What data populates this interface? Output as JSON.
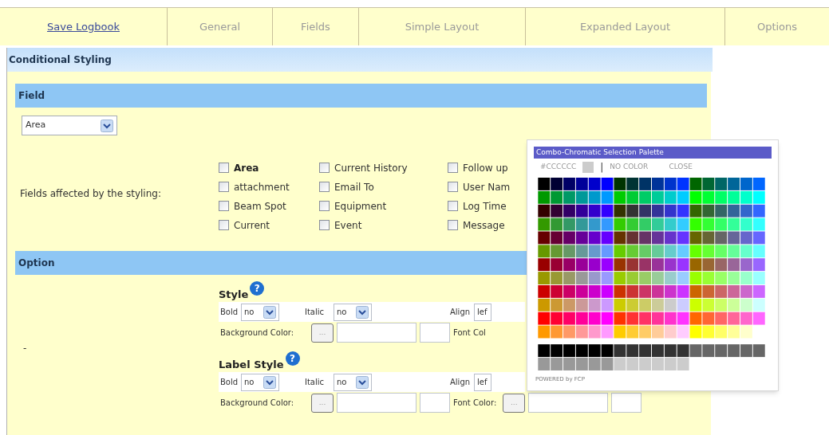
{
  "tabs": [
    {
      "label": "Save Logbook",
      "kind": "link"
    },
    {
      "label": "General",
      "kind": "tab"
    },
    {
      "label": "Fields",
      "kind": "tab"
    },
    {
      "label": "Simple Layout",
      "kind": "tab"
    },
    {
      "label": "Expanded Layout",
      "kind": "tab"
    },
    {
      "label": "Options",
      "kind": "tab"
    }
  ],
  "section_title": "Conditional Styling",
  "field_section": {
    "title": "Field",
    "select_value": "Area",
    "affected_label": "Fields affected by the styling:",
    "checkbox_columns": [
      [
        {
          "label": "Area",
          "checked": false,
          "highlighted": true
        },
        {
          "label": "attachment",
          "checked": false,
          "highlighted": false
        },
        {
          "label": "Beam Spot",
          "checked": false,
          "highlighted": false
        },
        {
          "label": "Current",
          "checked": false,
          "highlighted": false
        }
      ],
      [
        {
          "label": "Current History",
          "checked": false,
          "highlighted": false
        },
        {
          "label": "Email To",
          "checked": false,
          "highlighted": false
        },
        {
          "label": "Equipment",
          "checked": false,
          "highlighted": false
        },
        {
          "label": "Event",
          "checked": false,
          "highlighted": false
        }
      ],
      [
        {
          "label": "Follow up",
          "checked": false,
          "highlighted": false
        },
        {
          "label": "User Nam",
          "checked": false,
          "highlighted": false
        },
        {
          "label": "Log Time",
          "checked": false,
          "highlighted": false
        },
        {
          "label": "Message",
          "checked": false,
          "highlighted": false
        }
      ]
    ]
  },
  "option_section": {
    "title": "Option",
    "left_text": "-",
    "groups": [
      {
        "title": "Style",
        "help_icon": "?",
        "bold_label": "Bold",
        "bold_value": "no",
        "italic_label": "Italic",
        "italic_value": "no",
        "align_label": "Align",
        "align_value": "lef",
        "background_label": "Background Color:",
        "background_button": "...",
        "font_label": "Font Col"
      },
      {
        "title": "Label Style",
        "help_icon": "?",
        "bold_label": "Bold",
        "bold_value": "no",
        "italic_label": "Italic",
        "italic_value": "no",
        "align_label": "Align",
        "align_value": "lef",
        "background_label": "Background Color:",
        "background_button": "...",
        "font_label": "Font Color:",
        "font_button": "..."
      }
    ]
  },
  "palette": {
    "title": "Combo-Chromatic Selection Palette",
    "current_color": "#CCCCCC",
    "divider": "|",
    "no_color": "NO COLOR",
    "close": "CLOSE",
    "footer": "POWERED by FCP"
  }
}
